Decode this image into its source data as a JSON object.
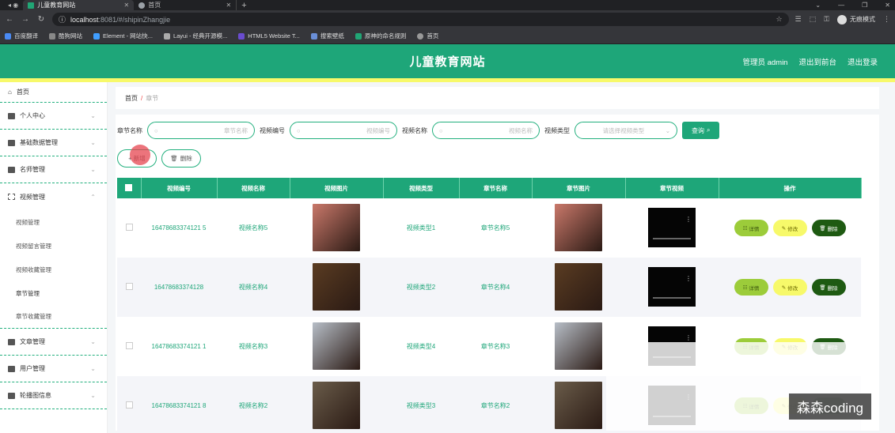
{
  "browser": {
    "tabs": [
      {
        "title": "儿童教育网站",
        "active": true
      },
      {
        "title": "首页",
        "active": false
      }
    ],
    "url_host": "localhost",
    "url_path": ":8081/#/shipinZhangjie",
    "incognito_label": "无痕模式",
    "bookmarks": [
      "百度翻译",
      "酷狗网站",
      "Element - 网站快...",
      "Layui - 经典开源模...",
      "HTML5 Website T...",
      "搜索壁纸",
      "原神的命名规则",
      "首页"
    ]
  },
  "header": {
    "title": "儿童教育网站",
    "admin": "管理员 admin",
    "back_to_console": "退出到前台",
    "logout": "退出登录"
  },
  "sidebar": {
    "home": "首页",
    "items": [
      {
        "label": "个人中心"
      },
      {
        "label": "基础数据管理"
      },
      {
        "label": "名师管理"
      },
      {
        "label": "视频管理",
        "expanded": true
      }
    ],
    "sub_items": [
      "视频管理",
      "视频留言管理",
      "视频收藏管理",
      "章节管理",
      "章节收藏管理"
    ],
    "items_after": [
      {
        "label": "文章管理"
      },
      {
        "label": "用户管理"
      },
      {
        "label": "轮播图信息"
      }
    ]
  },
  "breadcrumb": {
    "home": "首页",
    "sep": "/",
    "current": "章节"
  },
  "search": {
    "fields": [
      {
        "label": "章节名称",
        "placeholder": "章节名称"
      },
      {
        "label": "视频编号",
        "placeholder": "视频编号"
      },
      {
        "label": "视频名称",
        "placeholder": "视频名称"
      },
      {
        "label": "视频类型",
        "placeholder": "请选择视频类型"
      }
    ],
    "button": "查询"
  },
  "actions": {
    "add": "+ 新增",
    "delete": "删除"
  },
  "table": {
    "headers": [
      "视频编号",
      "视频名称",
      "视频图片",
      "视频类型",
      "章节名称",
      "章节图片",
      "章节视频",
      "操作"
    ],
    "rows": [
      {
        "code": "16478683374121 5",
        "name": "视频名称5",
        "type": "视频类型1",
        "chapter": "章节名称5",
        "img_color": "#c9786a"
      },
      {
        "code": "16478683374128",
        "name": "视频名称4",
        "type": "视频类型2",
        "chapter": "章节名称4",
        "img_color": "#5a3c22"
      },
      {
        "code": "16478683374121 1",
        "name": "视频名称3",
        "type": "视频类型4",
        "chapter": "章节名称3",
        "img_color": "#b7bec7"
      },
      {
        "code": "16478683374121 8",
        "name": "视频名称2",
        "type": "视频类型3",
        "chapter": "章节名称2",
        "img_color": "#6a5c4a"
      }
    ],
    "op_labels": {
      "detail": "详情",
      "edit": "修改",
      "del": "删除"
    }
  },
  "watermark": "森森coding"
}
